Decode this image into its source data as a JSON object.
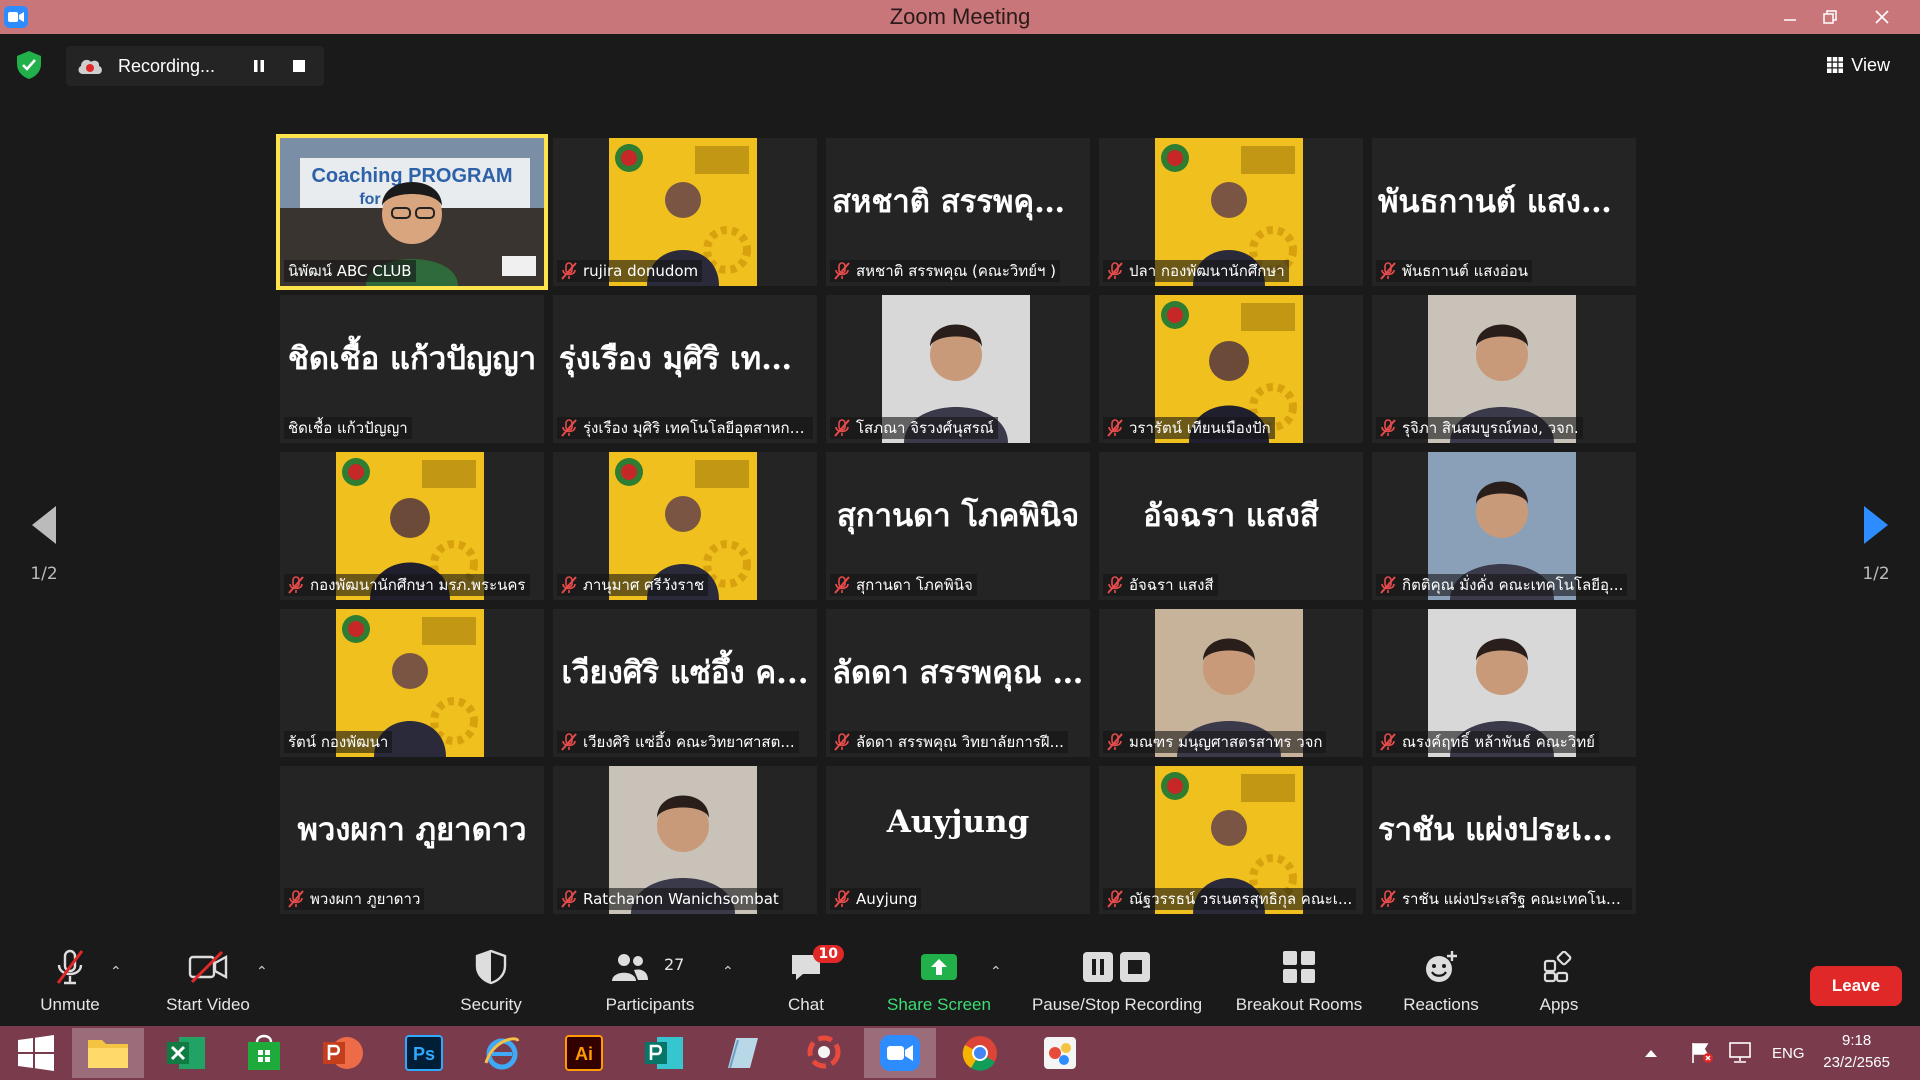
{
  "window": {
    "title": "Zoom Meeting",
    "controls": [
      "minimize",
      "restore",
      "close"
    ]
  },
  "topbar": {
    "recording_label": "Recording...",
    "view_label": "View"
  },
  "tiles": [
    {
      "name": "นิพัฒน์ ABC CLUB",
      "display": "video",
      "muted": false,
      "active": true
    },
    {
      "name": "rujira donudom",
      "display": "photo",
      "muted": true
    },
    {
      "name": "สหชาติ สรรพคุณ (คณะวิทย์ฯ )",
      "big": "สหชาติ สรรพคุณ...",
      "display": "name",
      "muted": true
    },
    {
      "name": "ปลา กองพัฒนานักศึกษา",
      "display": "photo",
      "muted": true
    },
    {
      "name": "พันธกานต์ แสงอ่อน",
      "big": "พันธกานต์ แสงอ่อน",
      "display": "name",
      "muted": true
    },
    {
      "name": "ชิดเชื้อ แก้วปัญญา",
      "big": "ชิดเชื้อ แก้วปัญญา",
      "display": "name",
      "muted": false
    },
    {
      "name": "รุ่งเรือง มุศิริ เทคโนโลยีอุตสาหกร...",
      "big": "รุ่งเรือง มุศิริ เทคโ...",
      "display": "name",
      "muted": true
    },
    {
      "name": "โสภณา จิรวงศ์นุสรณ์",
      "display": "photo",
      "muted": true
    },
    {
      "name": "วรารัตน์ เทียนเมืองปัก",
      "display": "photo",
      "muted": true
    },
    {
      "name": "รุจิภา สินสมบูรณ์ทอง, วจก.",
      "display": "photo",
      "muted": true
    },
    {
      "name": "กองพัฒนานักศึกษา มรภ.พระนคร",
      "display": "photo",
      "muted": true
    },
    {
      "name": "ภานุมาศ ศรีวังราช",
      "display": "photo",
      "muted": true
    },
    {
      "name": "สุกานดา โภคพินิจ",
      "big": "สุกานดา โภคพินิจ",
      "display": "name",
      "muted": true
    },
    {
      "name": "อัจฉรา แสงสี",
      "big": "อัจฉรา แสงสี",
      "display": "name",
      "muted": true
    },
    {
      "name": "กิตติคุณ มั่งคั่ง คณะเทคโนโลยีอุ...",
      "display": "photo",
      "muted": true
    },
    {
      "name": "รัตน์ กองพัฒนา",
      "display": "photo",
      "muted": false
    },
    {
      "name": "เวียงศิริ แซ่อึ้ง คณะวิทยาศาสต...",
      "big": "เวียงศิริ แซ่อึ้ง ค...",
      "display": "name",
      "muted": true
    },
    {
      "name": "ลัดดา สรรพคุณ วิทยาลัยการฝี...",
      "big": "ลัดดา สรรพคุณ วิ...",
      "display": "name",
      "muted": true
    },
    {
      "name": "มณฑร มนุญศาสตรสาทร วจก",
      "display": "photo",
      "muted": true
    },
    {
      "name": "ณรงค์ฤทธิ์ หล้าพันธ์ คณะวิทย์",
      "display": "photo",
      "muted": true
    },
    {
      "name": "พวงผกา ภูยาดาว",
      "big": "พวงผกา ภูยาดาว",
      "display": "name",
      "muted": true
    },
    {
      "name": "Ratchanon Wanichsombat",
      "display": "photo",
      "muted": true
    },
    {
      "name": "Auyjung",
      "big": "Auyjung",
      "display": "name",
      "muted": true
    },
    {
      "name": "ณัฐวรรธน์ วรเนตรสุทธิกุล คณะเ...",
      "display": "photo",
      "muted": true
    },
    {
      "name": "ราชัน แผ่งประเสริฐ คณะเทคโนโ...",
      "big": "ราชัน แผ่งประเส...",
      "display": "name",
      "muted": true
    }
  ],
  "pager": {
    "left": "1/2",
    "right": "1/2"
  },
  "toolbar": {
    "unmute": "Unmute",
    "start_video": "Start Video",
    "security": "Security",
    "participants": "Participants",
    "participants_count": "27",
    "chat": "Chat",
    "chat_badge": "10",
    "share_screen": "Share Screen",
    "pause_stop": "Pause/Stop Recording",
    "breakout": "Breakout Rooms",
    "reactions": "Reactions",
    "apps": "Apps",
    "leave": "Leave"
  },
  "taskbar": {
    "language": "ENG",
    "time": "9:18",
    "date": "23/2/2565",
    "apps": [
      "windows-start",
      "file-explorer",
      "excel",
      "store",
      "powerpoint",
      "photoshop",
      "internet-explorer",
      "illustrator",
      "publisher",
      "notes",
      "photoscape",
      "zoom",
      "chrome",
      "paint"
    ]
  },
  "colors": {
    "title_bar": "#c9767a",
    "taskbar": "#7a3b4d",
    "active_speaker": "#ffe34a",
    "leave": "#e02828",
    "share": "#3ddc74",
    "poster_yellow": "#f0c01e"
  }
}
